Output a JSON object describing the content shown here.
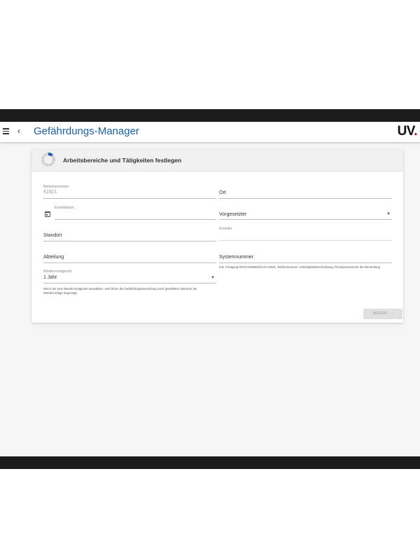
{
  "header": {
    "title": "Gefährdungs-Manager",
    "logo": "UV",
    "logo_dot": "."
  },
  "card": {
    "title": "Arbeitsbereiche und Tätigkeiten festlegen",
    "progress_fraction": 0.12
  },
  "fields": {
    "betriebsnummer": {
      "label": "Betriebsnummer",
      "value": "41921"
    },
    "ort": {
      "label": "Ort"
    },
    "erstelldatum": {
      "label": "Erstelldatum"
    },
    "vorgesetzter": {
      "label": "Vorgesetzter"
    },
    "standort": {
      "label": "Standort"
    },
    "ersteller": {
      "label": "Ersteller"
    },
    "abteilung": {
      "label": "Abteilung"
    },
    "systemnummer": {
      "label": "Systemnummer",
      "hint": "Z.B. Fertigung 00107126668101<br>Werk, Telefonnummer, Arbeitsplatzbeschreibung, Revisionsnummer der Beurteilung"
    },
    "wiedervorlagezeit": {
      "label": "Wiedervorlagezeit",
      "value": "1 Jahr",
      "hint": "Wenn Sie eine Wiedervorlagezeit auswählen, wird Ihnen die Gefährdungsbeurteilung nach gewähltem Zeitraum als Wiedervorlage angezeigt."
    }
  },
  "buttons": {
    "next_label": "WEITER",
    "next_icon": "chevron-right-icon"
  },
  "colors": {
    "accent": "#1a5fa8",
    "brand_red": "#d0021b"
  }
}
